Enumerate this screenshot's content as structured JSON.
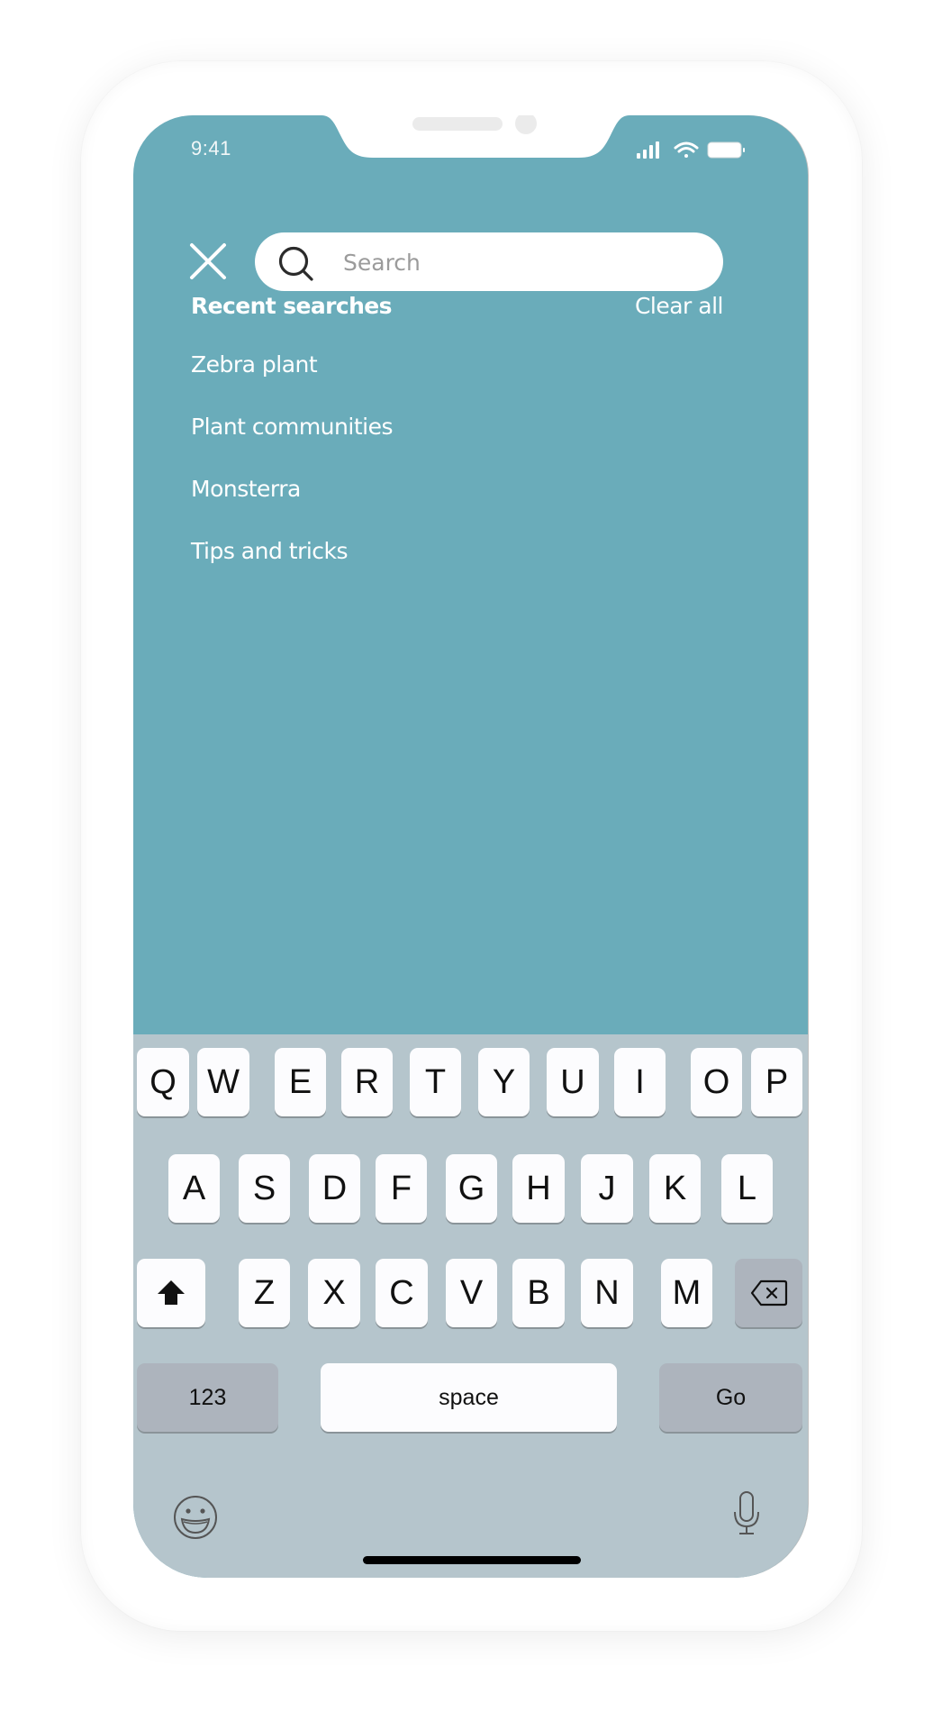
{
  "status_bar": {
    "time": "9:41",
    "icons": [
      "signal-icon",
      "wifi-icon",
      "battery-icon"
    ]
  },
  "search": {
    "placeholder": "Search",
    "value": "",
    "close_icon": "close-icon",
    "search_icon": "search-icon"
  },
  "recent": {
    "title": "Recent searches",
    "clear_label": "Clear all",
    "items": [
      "Zebra plant",
      "Plant communities",
      "Monsterra",
      "Tips and tricks"
    ]
  },
  "keyboard": {
    "row1": [
      "Q",
      "W",
      "E",
      "R",
      "T",
      "Y",
      "U",
      "I",
      "O",
      "P"
    ],
    "row2": [
      "A",
      "S",
      "D",
      "F",
      "G",
      "H",
      "J",
      "K",
      "L"
    ],
    "row3": [
      "Z",
      "X",
      "C",
      "V",
      "B",
      "N",
      "M"
    ],
    "shift_icon": "shift-icon",
    "delete_icon": "delete-icon",
    "numbers_label": "123",
    "space_label": "space",
    "go_label": "Go",
    "emoji_icon": "emoji-icon",
    "mic_icon": "microphone-icon"
  },
  "colors": {
    "background": "#6aacba",
    "keyboard": "#b5c5cc",
    "key": "#fcfcfe",
    "function_key": "#adb4bd"
  }
}
